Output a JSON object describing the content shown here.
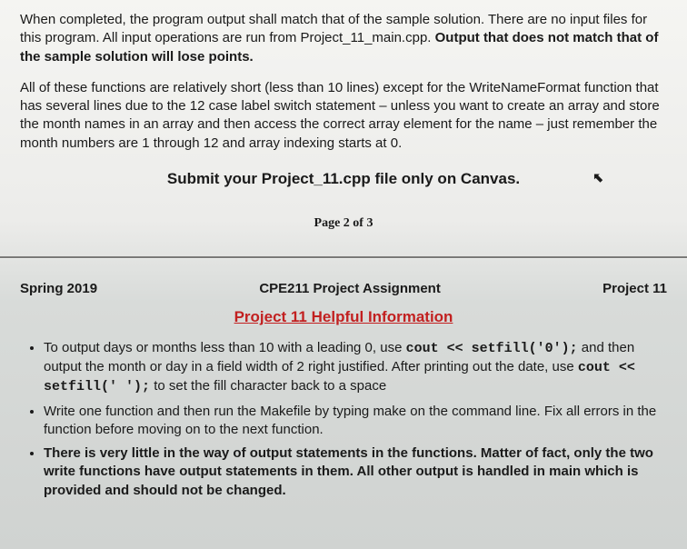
{
  "top": {
    "para1_a": "When completed, the program output shall match that of the sample solution. There are no input files for this program. All input operations are run from Project_11_main.cpp. ",
    "para1_b_bold": "Output that does not match that of the sample solution will lose points.",
    "para2": "All of these functions are relatively short (less than 10 lines) except for the WriteNameFormat function that has several lines due to the 12 case label switch statement – unless you want to create an array and store the month names in an array and then access the correct array element for the name – just remember the month numbers are 1 through 12 and array indexing starts at 0.",
    "submit": "Submit your Project_11.cpp file only on Canvas.",
    "cursor": "⬉",
    "page": "Page 2 of 3"
  },
  "header": {
    "left": "Spring 2019",
    "center": "CPE211 Project Assignment",
    "right": "Project 11"
  },
  "section_title": "Project 11 Helpful Information",
  "bullets": {
    "b1_a": "To output days or months less than 10 with a leading 0, use ",
    "b1_code1": "cout << setfill('0');",
    "b1_b": " and then output the month or day in a field width of 2 right justified. After printing out the date, use ",
    "b1_code2": "cout << setfill(' ');",
    "b1_c": " to set the fill character back to a space",
    "b2": "Write one function and then run the Makefile by typing make on the command line. Fix all errors in the function before moving on to the next function.",
    "b3": "There is very little in the way of output statements in the functions. Matter of fact, only the two write functions have output statements in them. All other output is handled in main which is provided and should not be changed."
  }
}
